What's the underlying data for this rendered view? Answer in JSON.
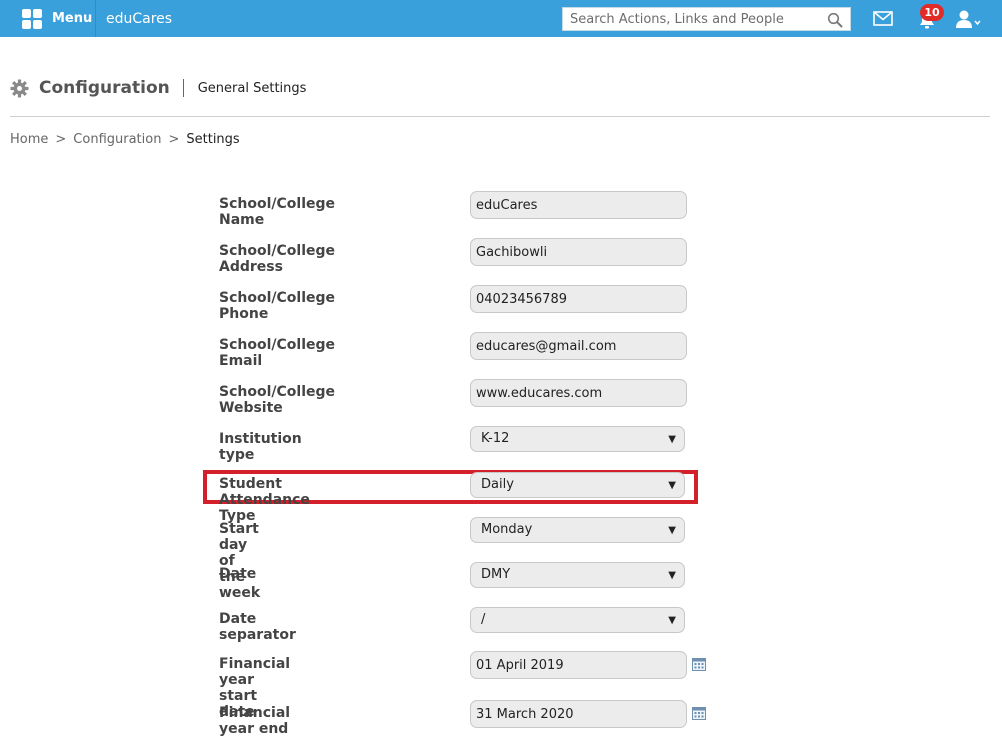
{
  "topbar": {
    "menu_label": "Menu",
    "brand": "eduCares",
    "search_placeholder": "Search Actions, Links and People",
    "notification_count": "10"
  },
  "header": {
    "title": "Configuration",
    "subtitle": "General Settings"
  },
  "breadcrumb": {
    "home": "Home",
    "configuration": "Configuration",
    "current": "Settings",
    "separator": ">"
  },
  "form": {
    "school_name": {
      "label": "School/College Name",
      "value": "eduCares"
    },
    "school_address": {
      "label": "School/College Address",
      "value": "Gachibowli"
    },
    "school_phone": {
      "label": "School/College Phone",
      "value": "04023456789"
    },
    "school_email": {
      "label": "School/College Email",
      "value": "educares@gmail.com"
    },
    "school_website": {
      "label": "School/College Website",
      "value": "www.educares.com"
    },
    "institution_type": {
      "label": "Institution type",
      "value": "K-12"
    },
    "attendance_type": {
      "label": "Student Attendance Type",
      "value": "Daily"
    },
    "start_day": {
      "label": "Start day of the week",
      "value": "Monday"
    },
    "date_format": {
      "label": "Date",
      "value": "DMY"
    },
    "date_separator": {
      "label": "Date separator",
      "value": "/"
    },
    "fy_start": {
      "label": "Financial year start date",
      "value": "01 April 2019"
    },
    "fy_end": {
      "label": "Financial year end date",
      "value": "31 March 2020"
    }
  },
  "colors": {
    "topbar": "#3aa0dc",
    "highlight": "#d4202a",
    "badge": "#e02b27"
  },
  "icons": {
    "menu": "grid-icon",
    "search": "search-icon",
    "mail": "mail-icon",
    "notifications": "bell-icon",
    "user": "user-icon",
    "settings": "gear-icon",
    "calendar": "calendar-icon",
    "dropdown": "chevron-down-icon"
  }
}
